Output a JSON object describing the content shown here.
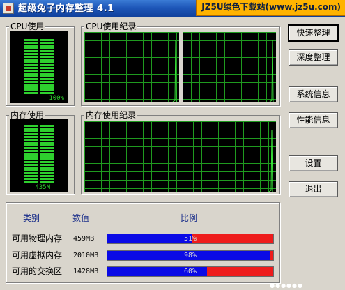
{
  "window": {
    "title": "超级兔子内存整理 4.1",
    "watermark": "JZ5U绿色下载站(www.jz5u.com)"
  },
  "cpu_usage": {
    "label": "CPU使用",
    "value_text": "100%",
    "level": 1.0
  },
  "cpu_history": {
    "label": "CPU使用纪录"
  },
  "mem_usage": {
    "label": "内存使用",
    "value_text": "435M",
    "level": 1.0
  },
  "mem_history": {
    "label": "内存使用纪录"
  },
  "buttons": {
    "quick": "快速整理",
    "deep": "深度整理",
    "sysinfo": "系统信息",
    "perfinfo": "性能信息",
    "settings": "设置",
    "exit": "退出"
  },
  "table": {
    "headers": {
      "category": "类别",
      "value": "数值",
      "ratio": "比例"
    },
    "rows": [
      {
        "label": "可用物理内存",
        "value": "459MB",
        "percent_text": "51%",
        "percent": 51
      },
      {
        "label": "可用虚拟内存",
        "value": "2010MB",
        "percent_text": "98%",
        "percent": 98
      },
      {
        "label": "可用的交换区",
        "value": "1428MB",
        "percent_text": "60%",
        "percent": 60
      }
    ]
  },
  "colors": {
    "titlebar": "#1d56b8",
    "gauge_on": "#2ed02e",
    "grid": "#1f9a1f",
    "bar_used": "#0a0ae6",
    "bar_free": "#ee1c1c",
    "watermark_bg": "#ffb300"
  }
}
